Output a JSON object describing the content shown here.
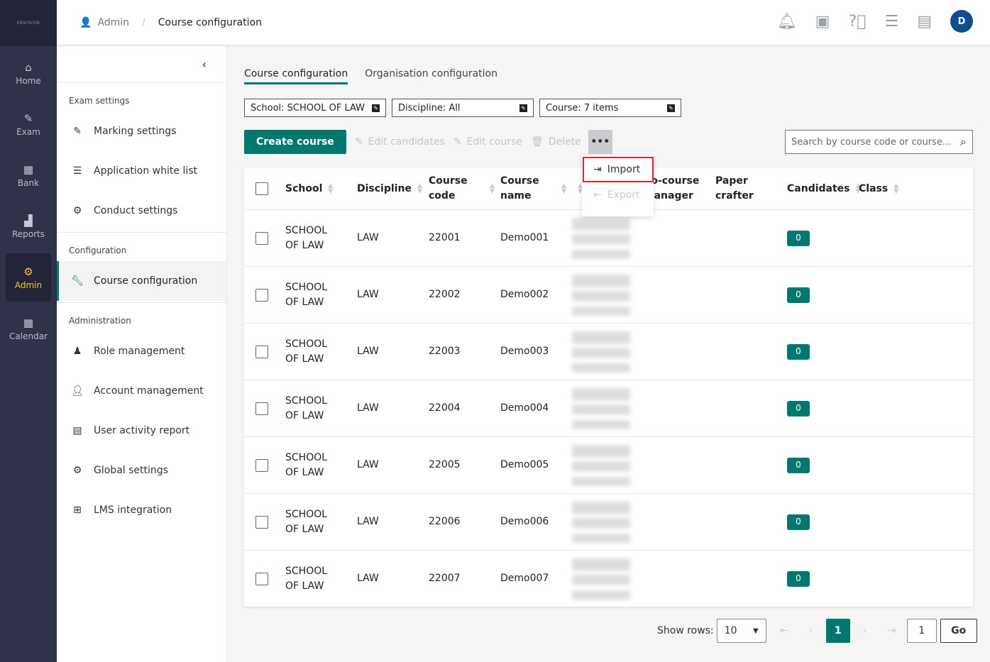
{
  "brand": {
    "logo": "KBVISION"
  },
  "rail": [
    {
      "label": "Home",
      "icon": "home-icon",
      "glyph": "⌂"
    },
    {
      "label": "Exam",
      "icon": "exam-icon",
      "glyph": "✎"
    },
    {
      "label": "Bank",
      "icon": "bank-icon",
      "glyph": "▦"
    },
    {
      "label": "Reports",
      "icon": "reports-icon",
      "glyph": "▟"
    },
    {
      "label": "Admin",
      "icon": "admin-icon",
      "glyph": "⚙",
      "active": true
    },
    {
      "label": "Calendar",
      "icon": "calendar-icon",
      "glyph": "▦"
    }
  ],
  "header": {
    "breadcrumb": [
      "Admin",
      "Course configuration"
    ],
    "avatar": "D"
  },
  "side": {
    "sections": [
      {
        "title": "Exam settings",
        "items": [
          "Marking settings",
          "Application white list",
          "Conduct settings"
        ]
      },
      {
        "title": "Configuration",
        "items": [
          "Course configuration"
        ]
      },
      {
        "title": "Administration",
        "items": [
          "Role management",
          "Account management",
          "User activity report",
          "Global settings",
          "LMS integration"
        ]
      }
    ]
  },
  "tabs": [
    "Course configuration",
    "Organisation configuration"
  ],
  "filters": [
    "School: SCHOOL OF LAW",
    "Discipline: All",
    "Course: 7 items"
  ],
  "toolbar": {
    "create": "Create course",
    "edit_candidates": "Edit candidates",
    "edit_course": "Edit course",
    "delete": "Delete",
    "more": "•••"
  },
  "search": {
    "placeholder": "Search by course code or course..."
  },
  "menu": {
    "import": "Import",
    "export": "Export"
  },
  "table": {
    "columns": [
      "School",
      "Discipline",
      "Course code",
      "Course name",
      "",
      "Co-course manager",
      "Paper crafter",
      "Candidates",
      "Class"
    ],
    "rows": [
      {
        "school": "SCHOOL OF LAW",
        "discipline": "LAW",
        "code": "22001",
        "name": "Demo001",
        "candidates": "0"
      },
      {
        "school": "SCHOOL OF LAW",
        "discipline": "LAW",
        "code": "22002",
        "name": "Demo002",
        "candidates": "0"
      },
      {
        "school": "SCHOOL OF LAW",
        "discipline": "LAW",
        "code": "22003",
        "name": "Demo003",
        "candidates": "0"
      },
      {
        "school": "SCHOOL OF LAW",
        "discipline": "LAW",
        "code": "22004",
        "name": "Demo004",
        "candidates": "0"
      },
      {
        "school": "SCHOOL OF LAW",
        "discipline": "LAW",
        "code": "22005",
        "name": "Demo005",
        "candidates": "0"
      },
      {
        "school": "SCHOOL OF LAW",
        "discipline": "LAW",
        "code": "22006",
        "name": "Demo006",
        "candidates": "0"
      },
      {
        "school": "SCHOOL OF LAW",
        "discipline": "LAW",
        "code": "22007",
        "name": "Demo007",
        "candidates": "0"
      }
    ]
  },
  "pager": {
    "show_rows_label": "Show rows:",
    "rows": "10",
    "current": "1",
    "goto": "1",
    "go": "Go"
  },
  "colors": {
    "accent": "#00786f",
    "rail": "#2f3249",
    "active": "#f4c430"
  }
}
